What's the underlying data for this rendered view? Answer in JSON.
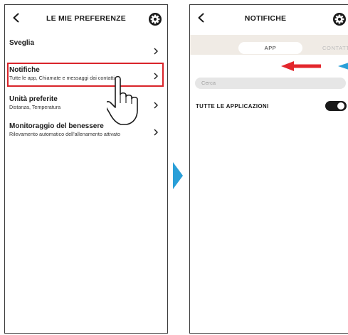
{
  "left_screen": {
    "title": "LE MIE PREFERENZE",
    "items": [
      {
        "title": "Sveglia",
        "subtitle": ""
      },
      {
        "title": "Notifiche",
        "subtitle": "Tutte le app, Chiamate e messaggi dai contatti"
      },
      {
        "title": "Unità preferite",
        "subtitle": "Distanza, Temperatura"
      },
      {
        "title": "Monitoraggio del benessere",
        "subtitle": "Rilevamento automatico dell'allenamento attivato"
      }
    ],
    "highlighted_item": "Notifiche"
  },
  "right_screen": {
    "title": "NOTIFICHE",
    "tabs": [
      "APP",
      "CONTATTI"
    ],
    "active_tab": "APP",
    "search_placeholder": "Cerca",
    "all_apps_label": "TUTTE LE APPLICAZIONI",
    "all_apps_enabled": true
  },
  "icons": {
    "back": "chevron-left-icon",
    "settings": "gear-icon",
    "chevron": "chevron-right-icon",
    "hand": "pointing-hand-icon",
    "flow": "triangle-right-icon",
    "swipe": "arrow-left-icon"
  },
  "colors": {
    "highlight": "#d9242a",
    "flow_arrow": "#2a9fd8",
    "swipe_arrow": "#e3262c",
    "tab_bar_bg": "#f0ebe5",
    "search_bg": "#e6e6e6",
    "toggle_on": "#1a1a1a"
  }
}
